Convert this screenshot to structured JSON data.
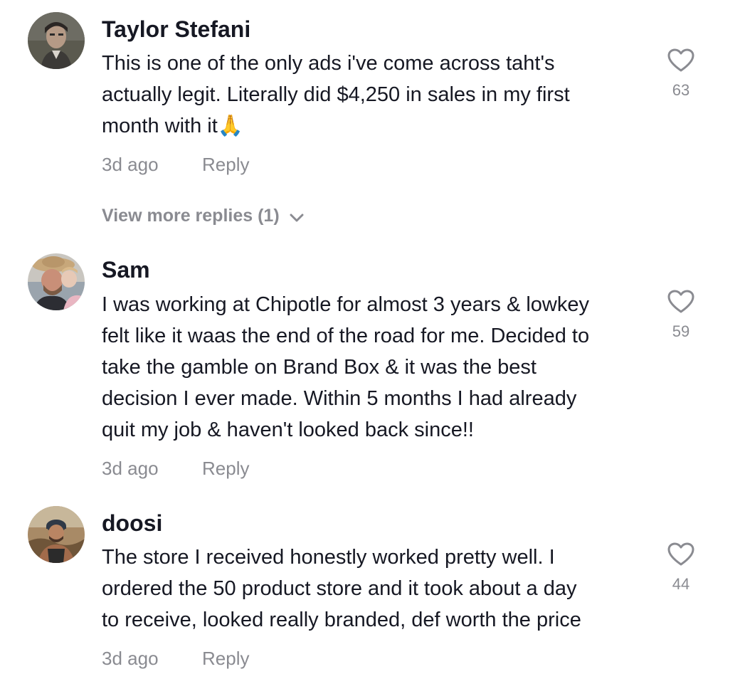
{
  "comments": [
    {
      "username": "Taylor Stefani",
      "lines": [
        "This is one of the only ads i've come across taht's",
        "actually legit. Literally did $4,250 in sales in my first",
        "month with it🙏"
      ],
      "time": "3d ago",
      "reply": "Reply",
      "likes": "63",
      "view_more": "View more replies (1)"
    },
    {
      "username": "Sam",
      "lines": [
        "I was working at Chipotle for almost 3 years & lowkey",
        "felt like it waas the end of the road for me. Decided to",
        "take the gamble on Brand Box & it was the best",
        "decision I ever made. Within 5 months I had already",
        "quit my job & haven't looked back since!!"
      ],
      "time": "3d ago",
      "reply": "Reply",
      "likes": "59"
    },
    {
      "username": "doosi",
      "lines": [
        "The store I received honestly worked pretty well. I",
        "ordered the 50 product store and it took about a day",
        "to receive, looked really branded, def worth the price"
      ],
      "time": "3d ago",
      "reply": "Reply",
      "likes": "44"
    }
  ],
  "colors": {
    "text": "#161823",
    "secondary": "#8a8b91",
    "heart_stroke": "#8a8b91"
  },
  "icons": [
    "heart-outline-icon",
    "chevron-down-icon"
  ]
}
